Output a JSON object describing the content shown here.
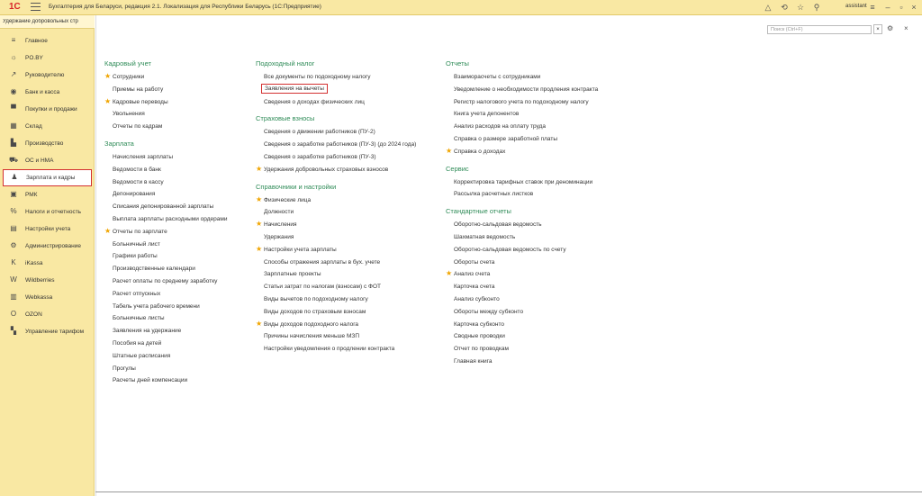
{
  "titlebar": {
    "logo": "1С",
    "title": "Бухгалтерия для Беларуси, редакция 2.1. Локализация для Республики Беларусь  (1С:Предприятие)",
    "user": "assistant"
  },
  "tab": {
    "label": "Удержание добровольных стр"
  },
  "sections": [
    {
      "label": "Главное",
      "icon": "≡"
    },
    {
      "label": "PO.BY",
      "icon": "☼"
    },
    {
      "label": "Руководителю",
      "icon": "↗"
    },
    {
      "label": "Банк и касса",
      "icon": "◉"
    },
    {
      "label": "Покупки и продажи",
      "icon": "▀"
    },
    {
      "label": "Склад",
      "icon": "▦"
    },
    {
      "label": "Производство",
      "icon": "▙"
    },
    {
      "label": "ОС и НМА",
      "icon": "⛟"
    },
    {
      "label": "Зарплата и кадры",
      "icon": "♟"
    },
    {
      "label": "РМК",
      "icon": "▣"
    },
    {
      "label": "Налоги и отчетность",
      "icon": "%"
    },
    {
      "label": "Настройки учета",
      "icon": "▤"
    },
    {
      "label": "Администрирование",
      "icon": "⚙"
    },
    {
      "label": "iKassa",
      "icon": "K"
    },
    {
      "label": "Wildberries",
      "icon": "W"
    },
    {
      "label": "Webkassa",
      "icon": "▥"
    },
    {
      "label": "OZON",
      "icon": "O"
    },
    {
      "label": "Управление тарифом",
      "icon": "▚"
    }
  ],
  "search": {
    "placeholder": "Поиск (Ctrl+F)",
    "clear": "×"
  },
  "columns": [
    [
      {
        "title": "Кадровый учет",
        "items": [
          {
            "t": "Сотрудники",
            "star": true
          },
          {
            "t": "Приемы на работу"
          },
          {
            "t": "Кадровые переводы",
            "star": true
          },
          {
            "t": "Увольнения"
          },
          {
            "t": "Отчеты по кадрам"
          }
        ]
      },
      {
        "title": "Зарплата",
        "items": [
          {
            "t": "Начисления зарплаты"
          },
          {
            "t": "Ведомости в банк"
          },
          {
            "t": "Ведомости в кассу"
          },
          {
            "t": "Депонирования"
          },
          {
            "t": "Списания депонированной зарплаты"
          },
          {
            "t": "Выплата зарплаты расходными ордерами"
          },
          {
            "t": "Отчеты по зарплате",
            "star": true
          },
          {
            "t": "Больничный лист"
          },
          {
            "t": "Графики работы"
          },
          {
            "t": "Производственные календари"
          },
          {
            "t": "Расчет оплаты по среднему заработку"
          },
          {
            "t": "Расчет отпускных"
          },
          {
            "t": "Табель учета рабочего времени"
          },
          {
            "t": "Больничные листы"
          },
          {
            "t": "Заявления на удержание"
          },
          {
            "t": "Пособия на детей"
          },
          {
            "t": "Штатные расписания"
          },
          {
            "t": "Прогулы"
          },
          {
            "t": "Расчеты дней компенсации"
          }
        ]
      }
    ],
    [
      {
        "title": "Подоходный налог",
        "items": [
          {
            "t": "Все документы по подоходному налогу"
          },
          {
            "t": "Заявления на вычеты",
            "boxed": true
          },
          {
            "t": "Сведения о доходах физических лиц"
          }
        ]
      },
      {
        "title": "Страховые взносы",
        "items": [
          {
            "t": "Сведения о движении работников (ПУ-2)"
          },
          {
            "t": "Сведения о заработке работников (ПУ-3) (до 2024 года)"
          },
          {
            "t": "Сведения о заработке работников (ПУ-3)"
          },
          {
            "t": "Удержания добровольных страховых взносов",
            "star": true
          }
        ]
      },
      {
        "title": "Справочники и настройки",
        "items": [
          {
            "t": "Физические лица",
            "star": true
          },
          {
            "t": "Должности"
          },
          {
            "t": "Начисления",
            "star": true
          },
          {
            "t": "Удержания"
          },
          {
            "t": "Настройки учета зарплаты",
            "star": true
          },
          {
            "t": "Способы отражения зарплаты в бух. учете"
          },
          {
            "t": "Зарплатные проекты"
          },
          {
            "t": "Статьи затрат по налогам (взносам) с ФОТ"
          },
          {
            "t": "Виды вычетов по подоходному налогу"
          },
          {
            "t": "Виды доходов по страховым взносам"
          },
          {
            "t": "Виды доходов подоходного налога",
            "star": true
          },
          {
            "t": "Причины начисления меньше МЗП"
          },
          {
            "t": "Настройки уведомления о продлении контракта"
          }
        ]
      }
    ],
    [
      {
        "title": "Отчеты",
        "items": [
          {
            "t": "Взаиморасчеты с сотрудниками"
          },
          {
            "t": "Уведомление о необходимости продления контракта"
          },
          {
            "t": "Регистр налогового учета по подоходному налогу"
          },
          {
            "t": "Книга учета депонентов"
          },
          {
            "t": "Анализ расходов на оплату труда"
          },
          {
            "t": "Справка о размере заработной платы"
          },
          {
            "t": "Справка о доходах",
            "star": true
          }
        ]
      },
      {
        "title": "Сервис",
        "items": [
          {
            "t": "Корректировка тарифных ставок при деноминации"
          },
          {
            "t": "Рассылка расчетных листков"
          }
        ]
      },
      {
        "title": "Стандартные отчеты",
        "items": [
          {
            "t": "Оборотно-сальдовая ведомость"
          },
          {
            "t": "Шахматная ведомость"
          },
          {
            "t": "Оборотно-сальдовая ведомость по счету"
          },
          {
            "t": "Обороты счета"
          },
          {
            "t": "Анализ счета",
            "star": true
          },
          {
            "t": "Карточка счета"
          },
          {
            "t": "Анализ субконто"
          },
          {
            "t": "Обороты между субконто"
          },
          {
            "t": "Карточка субконто"
          },
          {
            "t": "Сводные проводки"
          },
          {
            "t": "Отчет по проводкам"
          },
          {
            "t": "Главная книга"
          }
        ]
      }
    ]
  ]
}
